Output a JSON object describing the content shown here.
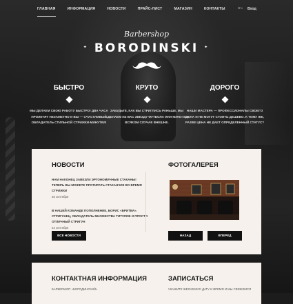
{
  "nav": {
    "items": [
      {
        "label": "Главная",
        "active": true
      },
      {
        "label": "Информация",
        "active": false
      },
      {
        "label": "Новости",
        "active": false
      },
      {
        "label": "Прайс-лист",
        "active": false
      },
      {
        "label": "Магазин",
        "active": false
      },
      {
        "label": "Контакты",
        "active": false
      }
    ],
    "login_label": "Вход",
    "login_icon": "key-icon"
  },
  "hero": {
    "script": "Barbershop",
    "name": "BORODINSKI",
    "mustache_icon": "mustache-icon"
  },
  "features": [
    {
      "title": "Быстро",
      "text": "Мы делаем свою работу быстро! Два часа пролетят незаметно и вы — счастливый обладатель стильной стрижки-минутки!"
    },
    {
      "title": "Круто",
      "text": "Забудьте, как вы стриглись раньше. Мы сделаем из вас звезду футбола или кино! Во всяком случае внешне."
    },
    {
      "title": "Дорого",
      "text": "Наши мастера — профессионалы своего дела и не могут стоить дешево. К тому же, разве цена не дает определенный статус?"
    }
  ],
  "news": {
    "title": "Новости",
    "items": [
      {
        "text": "Нам наконец завезли эргономичные стаканы! Теперь вы можете протирать стаканчик во время стрижки",
        "date": "25 сентября"
      },
      {
        "text": "В нашей команде пополнение, Борис «Бритва». Стригунец, обладатель множества титулов и просто отличный стригун",
        "date": "24 сентября"
      }
    ],
    "all_button": "Все новости"
  },
  "gallery": {
    "title": "Фотогалерея",
    "prev_button": "Назад",
    "next_button": "Вперед"
  },
  "contacts": {
    "title": "Контактная информация",
    "line": "Барбершоп «Бородинский»"
  },
  "booking": {
    "title": "Записаться",
    "line": "Укажите желаемую дату и время и мы свяжемся"
  }
}
